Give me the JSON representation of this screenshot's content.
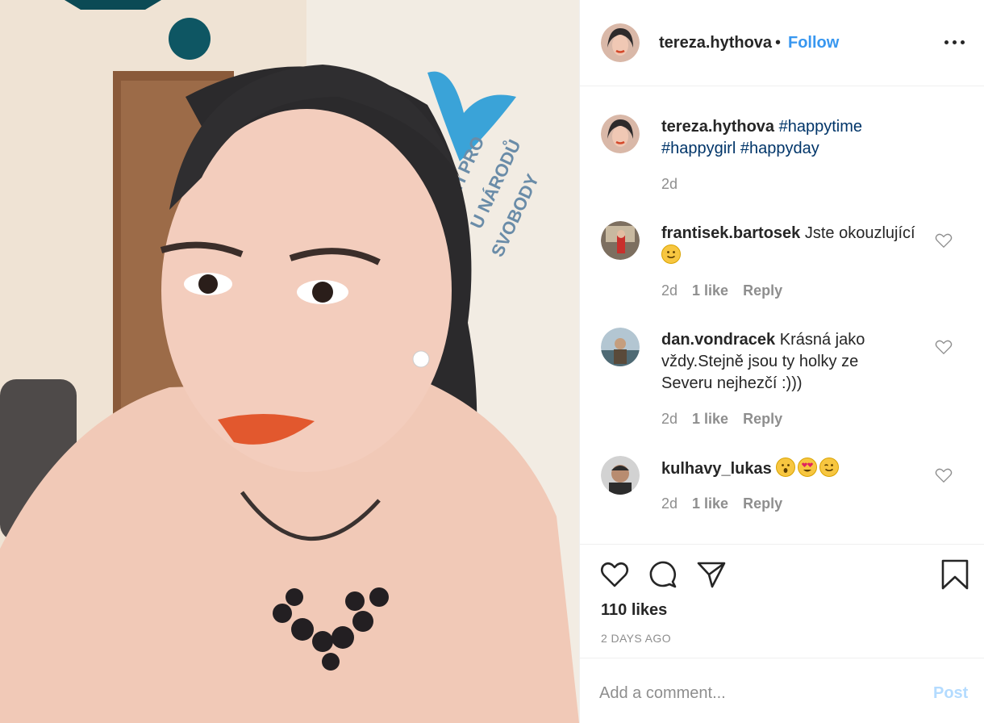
{
  "post": {
    "username": "tereza.hythova",
    "separator": "•",
    "follow_label": "Follow",
    "caption": {
      "username": "tereza.hythova",
      "hashtags": [
        "#happytime",
        "#happygirl",
        "#happyday"
      ],
      "time": "2d"
    },
    "photo_background_text": "TÍ PRO\nU NÁRODŮ\nSVOBODY",
    "likes_label": "110 likes",
    "time_ago": "2 DAYS AGO",
    "add_comment_placeholder": "Add a comment...",
    "post_label": "Post"
  },
  "comments": [
    {
      "username": "frantisek.bartosek",
      "text": "Jste okouzlující",
      "emoji": [
        "slightly-smiling"
      ],
      "time": "2d",
      "likes": "1 like",
      "reply": "Reply"
    },
    {
      "username": "dan.vondracek",
      "text": "Krásná jako vždy.Stejně jsou ty holky ze Severu nejhezčí :)))",
      "emoji": [],
      "time": "2d",
      "likes": "1 like",
      "reply": "Reply"
    },
    {
      "username": "kulhavy_lukas",
      "text": "",
      "emoji": [
        "astonished",
        "heart-eyes",
        "winking"
      ],
      "time": "2d",
      "likes": "1 like",
      "reply": "Reply"
    }
  ],
  "icons": {
    "more": "more-horizontal-icon",
    "like": "heart-icon",
    "comment": "comment-bubble-icon",
    "share": "paper-plane-icon",
    "save": "bookmark-icon"
  },
  "colors": {
    "link_blue": "#3897f0",
    "hashtag_blue": "#003569",
    "muted_gray": "#8e8e8e",
    "post_disabled": "#b3dbff"
  }
}
